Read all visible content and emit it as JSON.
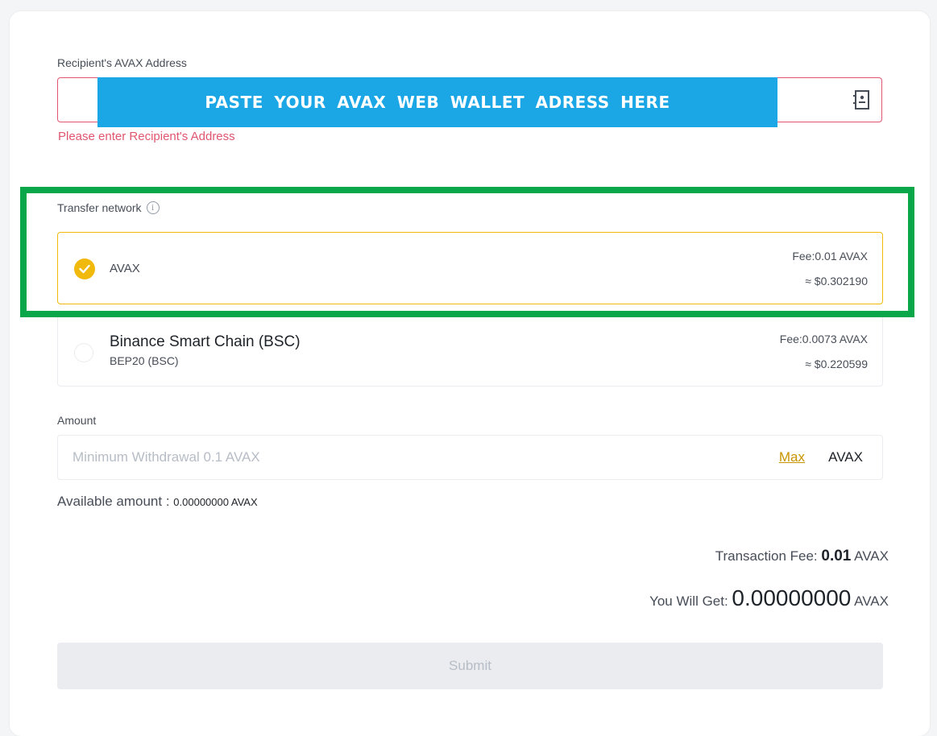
{
  "recipient": {
    "label": "Recipient's AVAX Address",
    "error": "Please enter Recipient's Address",
    "overlay_text": "PASTE YOUR AVAX WEB WALLET ADRESS HERE"
  },
  "network": {
    "label": "Transfer network",
    "info_icon": "i",
    "options": [
      {
        "name": "AVAX",
        "subtitle": "",
        "fee": "Fee:0.01 AVAX",
        "fee_usd": "≈ $0.302190",
        "selected": true
      },
      {
        "name": "Binance Smart Chain (BSC)",
        "subtitle": "BEP20 (BSC)",
        "fee": "Fee:0.0073 AVAX",
        "fee_usd": "≈ $0.220599",
        "selected": false
      }
    ]
  },
  "amount": {
    "label": "Amount",
    "placeholder": "Minimum Withdrawal 0.1 AVAX",
    "max_label": "Max",
    "unit": "AVAX",
    "available_label": "Available amount : ",
    "available_value": "0.00000000 AVAX"
  },
  "summary": {
    "fee_label": "Transaction Fee: ",
    "fee_value": "0.01",
    "fee_unit": "AVAX",
    "get_label": "You Will Get: ",
    "get_value": "0.00000000",
    "get_unit": "AVAX"
  },
  "submit_label": "Submit",
  "colors": {
    "accent": "#f0b90b",
    "error": "#e0566e",
    "overlay": "#1ba6e6",
    "highlight_frame": "#0aa64a"
  }
}
